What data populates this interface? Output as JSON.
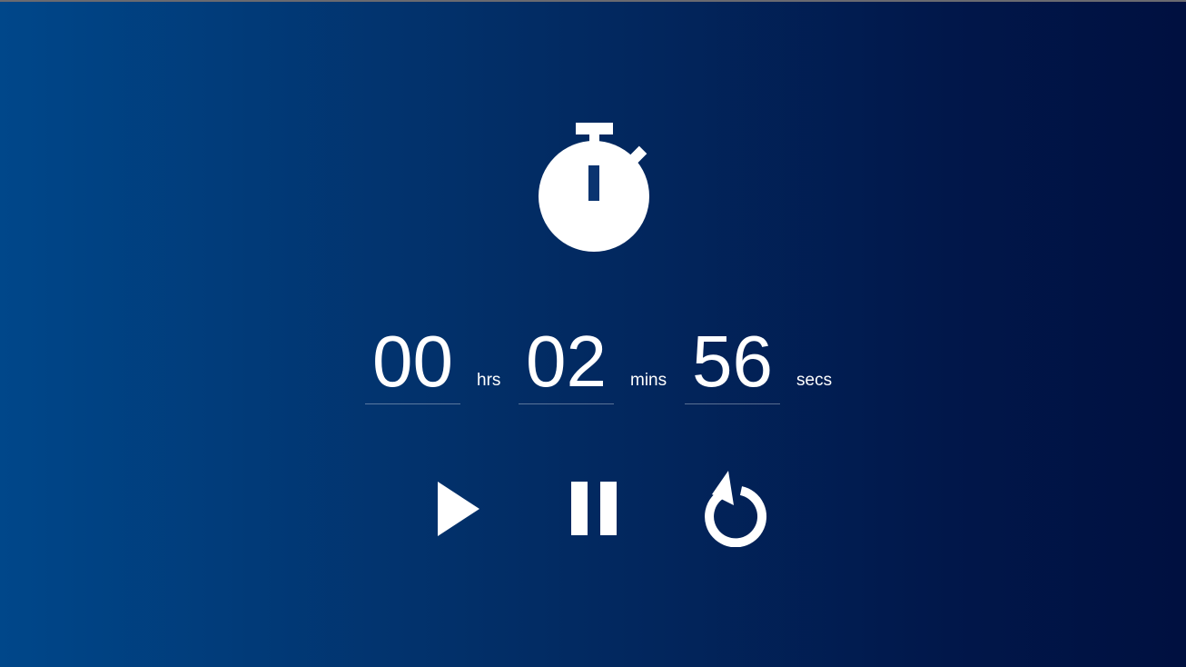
{
  "app": {
    "background_colors": [
      "#00478a",
      "#022f68",
      "#01174a",
      "#001040"
    ],
    "text_color": "#ffffff"
  },
  "icons": {
    "header": "stopwatch-icon",
    "play": "play-icon",
    "pause": "pause-icon",
    "reset": "restart-icon"
  },
  "timer": {
    "hours": "00",
    "hours_label": "hrs",
    "minutes": "02",
    "minutes_label": "mins",
    "seconds": "56",
    "seconds_label": "secs"
  }
}
